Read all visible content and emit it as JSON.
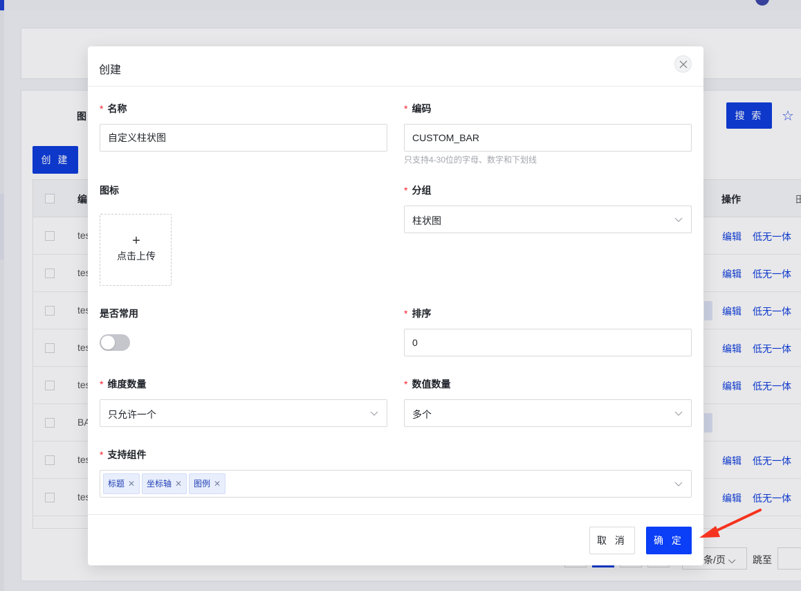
{
  "background": {
    "filter_label": "图",
    "create_button": "创 建",
    "search_button": "搜 索",
    "table": {
      "header_code": "编",
      "header_ops": "操作",
      "header_more": "田",
      "rows": [
        {
          "code": "tes",
          "edit": "编辑",
          "other": "低无一体"
        },
        {
          "code": "tes",
          "edit": "编辑",
          "other": "低无一体"
        },
        {
          "code": "tes",
          "edit": "编辑",
          "other": "低无一体"
        },
        {
          "code": "tes",
          "edit": "编辑",
          "other": "低无一体"
        },
        {
          "code": "tes",
          "edit": "编辑",
          "other": "低无一体"
        },
        {
          "code": "BA",
          "edit": "",
          "other": ""
        },
        {
          "code": "tes",
          "edit": "编辑",
          "other": "低无一体"
        },
        {
          "code": "tes",
          "edit": "编辑",
          "other": "低无一体"
        }
      ]
    },
    "pagination": {
      "page_size": "条/页",
      "jump_label": "跳至"
    }
  },
  "modal": {
    "title": "创建",
    "fields": {
      "name": {
        "label": "名称",
        "value": "自定义柱状图",
        "required": true
      },
      "code": {
        "label": "编码",
        "value": "CUSTOM_BAR",
        "hint": "只支持4-30位的字母、数字和下划线",
        "required": true
      },
      "icon": {
        "label": "图标",
        "upload_text": "点击上传",
        "upload_plus": "+"
      },
      "group": {
        "label": "分组",
        "value": "柱状图",
        "required": true
      },
      "common": {
        "label": "是否常用",
        "checked": false
      },
      "sort": {
        "label": "排序",
        "value": "0",
        "required": true
      },
      "dim_count": {
        "label": "维度数量",
        "value": "只允许一个",
        "required": true
      },
      "value_count": {
        "label": "数值数量",
        "value": "多个",
        "required": true
      },
      "components": {
        "label": "支持组件",
        "tags": [
          "标题",
          "坐标轴",
          "图例"
        ],
        "required": true
      }
    },
    "footer": {
      "cancel": "取 消",
      "ok": "确 定"
    }
  },
  "colors": {
    "primary": "#0a3ef7",
    "required": "#f5222d",
    "annotation_arrow": "#f5331f"
  }
}
